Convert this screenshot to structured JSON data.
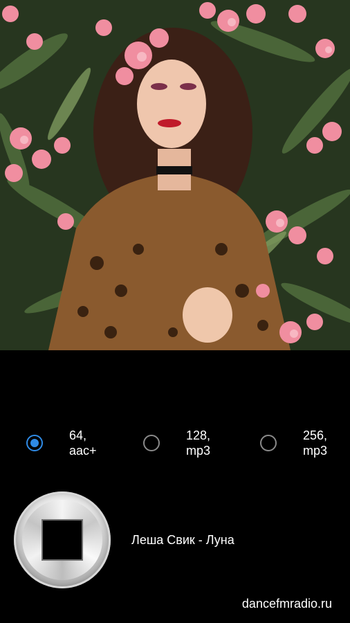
{
  "cover": {
    "alt": "Album cover artwork"
  },
  "quality_options": [
    {
      "label": "64,\naac+",
      "selected": true
    },
    {
      "label": "128,\nmp3",
      "selected": false
    },
    {
      "label": "256,\nmp3",
      "selected": false
    }
  ],
  "player": {
    "button_icon": "stop-icon",
    "track_title": "Леша Свик - Луна"
  },
  "footer": {
    "site": "dancefmradio.ru"
  },
  "colors": {
    "background": "#000000",
    "radio_accent": "#2f8be6",
    "radio_off": "#8a8a8a",
    "text": "#ffffff"
  }
}
